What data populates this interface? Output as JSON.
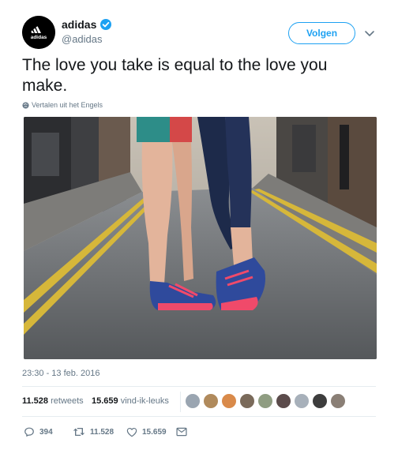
{
  "author": {
    "display_name": "adidas",
    "handle": "@adidas",
    "verified": true,
    "avatar_logo_text": "adidas"
  },
  "follow_button": {
    "label": "Volgen"
  },
  "tweet": {
    "text": "The love you take is equal to the love you make.",
    "translate_label": "Vertalen uit het Engels",
    "timestamp": "23:30 - 13 feb. 2016"
  },
  "stats": {
    "retweets_count": "11.528",
    "retweets_label": "retweets",
    "likes_count": "15.659",
    "likes_label": "vind-ik-leuks"
  },
  "likers": [
    {
      "color": "#9aa5b1"
    },
    {
      "color": "#b08a5c"
    },
    {
      "color": "#d98a4a"
    },
    {
      "color": "#7a6a5a"
    },
    {
      "color": "#8f9d82"
    },
    {
      "color": "#5b4b4b"
    },
    {
      "color": "#a7b0ba"
    },
    {
      "color": "#3d3d3d"
    },
    {
      "color": "#8a7f76"
    }
  ],
  "actions": {
    "replies": "394",
    "retweets": "11.528",
    "likes": "15.659"
  },
  "colors": {
    "accent": "#1da1f2",
    "text": "#14171a",
    "muted": "#657786",
    "shoe_blue": "#2f4a9c",
    "shoe_pink": "#f04a6a"
  }
}
